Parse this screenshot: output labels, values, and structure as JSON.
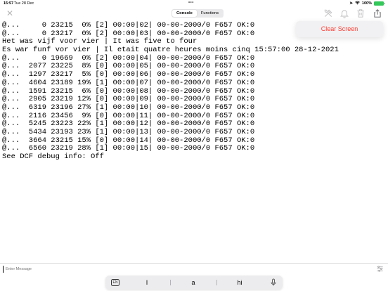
{
  "status": {
    "time": "15:57",
    "date": "Tue 28 Dec",
    "battery": "100%",
    "battery_color": "#34c759"
  },
  "toolbar": {
    "tabs": [
      {
        "label": "Console",
        "active": true
      },
      {
        "label": "Functions",
        "active": false
      }
    ],
    "icons": [
      "close-icon",
      "tools-icon",
      "bell-icon",
      "trash-icon",
      "share-icon"
    ]
  },
  "popover": {
    "clear_label": "Clear Screen",
    "clear_color": "#ff3b30"
  },
  "console": {
    "lines": [
      "@...     0 23215  0% [2] 00:00|02| 00-00-2000/0 F657 OK:0",
      "@...     0 23217  0% [2] 00:00|03| 00-00-2000/0 F657 OK:0",
      "Het was vijf voor vier | It was five to four",
      "Es war funf vor vier | Il etait quatre heures moins cinq 15:57:00 28-12-2021",
      "@...     0 19669  0% [2] 00:00|04| 00-00-2000/0 F657 OK:0",
      "@...  2077 23225  8% [0] 00:00|05| 00-00-2000/0 F657 OK:0",
      "@...  1297 23217  5% [0] 00:00|06| 00-00-2000/0 F657 OK:0",
      "@...  4604 23189 19% [1] 00:00|07| 00-00-2000/0 F657 OK:0",
      "@...  1591 23215  6% [0] 00:00|08| 00-00-2000/0 F657 OK:0",
      "@...  2905 23219 12% [0] 00:00|09| 00-00-2000/0 F657 OK:0",
      "@...  6319 23196 27% [1] 00:00|10| 00-00-2000/0 F657 OK:0",
      "@...  2116 23456  9% [0] 00:00|11| 00-00-2000/0 F657 OK:0",
      "@...  5245 23223 22% [1] 00:00|12| 00-00-2000/0 F657 OK:0",
      "@...  5434 23193 23% [1] 00:00|13| 00-00-2000/0 F657 OK:0",
      "@...  3664 23215 15% [0] 00:00|14| 00-00-2000/0 F657 OK:0",
      "@...  6560 23219 28% [1] 00:00|15| 00-00-2000/0 F657 OK:0",
      "See DCF debug info: Off"
    ]
  },
  "input": {
    "placeholder": "Enter Message"
  },
  "keyboard": {
    "lang": "EN",
    "suggestions": [
      "I",
      "a",
      "hi"
    ]
  }
}
